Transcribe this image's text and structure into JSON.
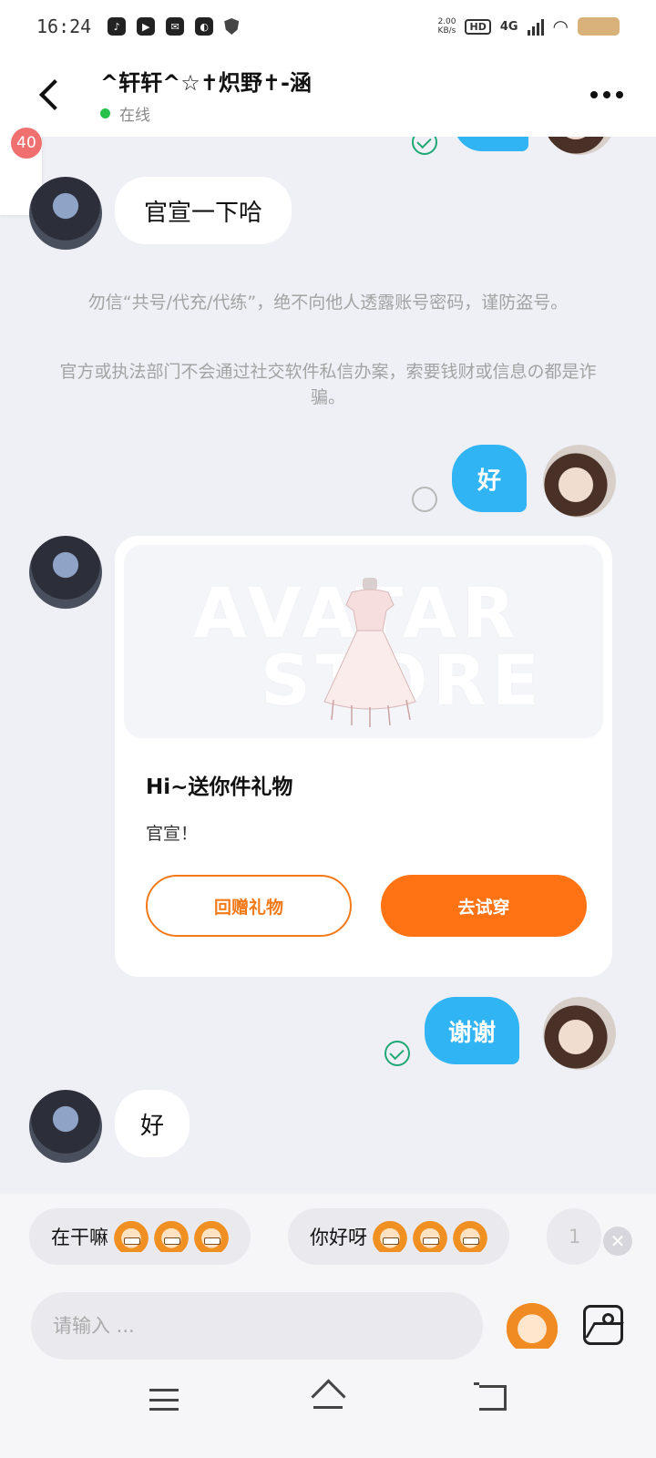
{
  "status_bar": {
    "time": "16:24",
    "net_speed_value": "2.00",
    "net_speed_unit": "KB/s",
    "hd_label": "HD",
    "network_label": "4G"
  },
  "header": {
    "title": "^轩轩^☆✝炽野✝-涵",
    "status": "在线"
  },
  "badge_count": "40",
  "messages": {
    "m1": "官宣一下哈",
    "m2": "好",
    "m3": "谢谢",
    "m4": "好"
  },
  "notice": {
    "line1": "勿信“共号/代充/代练”，绝不向他人透露账号密码，谨防盗号。",
    "line2": "官方或执法部门不会通过社交软件私信办案，索要钱财或信息の都是诈骗。"
  },
  "gift_card": {
    "watermark_top": "AVATAR",
    "watermark_bottom": "STORE",
    "title": "Hi~送你件礼物",
    "message": "官宣！",
    "return_gift_button": "回赠礼物",
    "try_on_button": "去试穿"
  },
  "quick_replies": [
    "在干嘛",
    "你好呀",
    "1"
  ],
  "input": {
    "placeholder": "请输入 ..."
  },
  "icons": [
    "back-arrow-icon",
    "more-icon",
    "read-check-icon",
    "pending-circle-icon",
    "close-icon",
    "sticker-icon",
    "image-icon",
    "menu-icon",
    "home-icon",
    "back-icon"
  ],
  "colors": {
    "my_bubble": "#31b4f4",
    "accent_orange": "#ff7315",
    "read_tick": "#1fa876",
    "online_dot": "#29c04b"
  }
}
